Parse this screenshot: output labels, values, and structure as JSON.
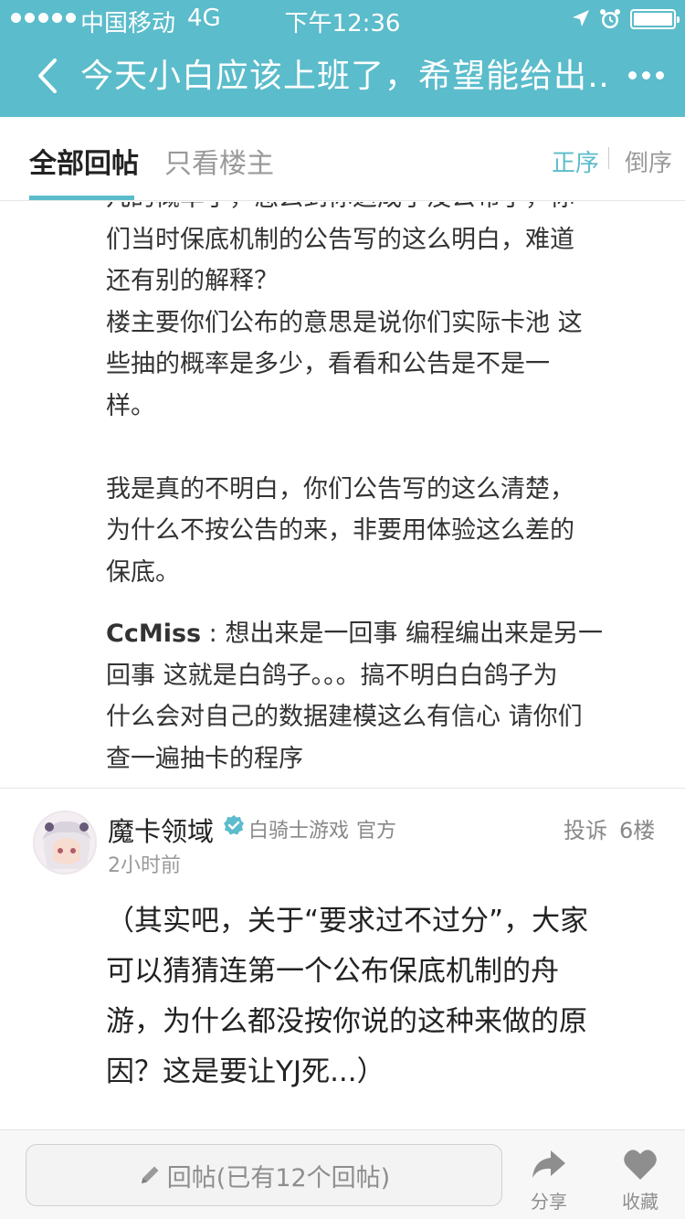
{
  "status_bar": {
    "carrier": "中国移动",
    "network": "4G",
    "time": "下午12:36"
  },
  "nav": {
    "title": "今天小白应该上班了，希望能给出…"
  },
  "tabs": {
    "all_replies": "全部回帖",
    "owner_only": "只看楼主",
    "sort_asc": "正序",
    "sort_desc": "倒序"
  },
  "reply_block": {
    "lines_1": [
      "几的概率了，怎么到你这成了没公布了，你",
      "们当时保底机制的公告写的这么明白，难道",
      "还有别的解释？",
      "楼主要你们公布的意思是说你们实际卡池 这",
      "些抽的概率是多少，看看和公告是不是一",
      "样。"
    ],
    "lines_2": [
      "我是真的不明白，你们公告写的这么清楚，",
      "为什么不按公告的来，非要用体验这么差的",
      "保底。"
    ],
    "sub_reply": {
      "author": "CcMiss",
      "separator": " : ",
      "first_line": "想出来是一回事 编程编出来是另一",
      "lines": [
        "回事  这就是白鸽子。。。搞不明白白鸽子为",
        "什么会对自己的数据建模这么有信心  请你们",
        "查一遍抽卡的程序"
      ]
    }
  },
  "post": {
    "username": "魔卡领域",
    "org": "白骑士游戏",
    "official": "官方",
    "report": "投诉",
    "floor": "6楼",
    "time": "2小时前",
    "lines": [
      "（其实吧，关于“要求过不过分”，大家",
      "可以猜猜连第一个公布保底机制的舟",
      "游，为什么都没按你说的这种来做的原",
      "因？这是要让YJ死...）"
    ]
  },
  "bottom_bar": {
    "reply_placeholder": "回帖(已有12个回帖)",
    "share": "分享",
    "favorite": "收藏"
  },
  "colors": {
    "accent": "#5bbccb",
    "text_primary": "#222222",
    "text_secondary": "#999999"
  },
  "icons": [
    "back-arrow-icon",
    "more-icon",
    "verified-icon",
    "pencil-icon",
    "share-icon",
    "heart-icon",
    "location-icon",
    "alarm-icon",
    "battery-icon",
    "signal-icon"
  ]
}
